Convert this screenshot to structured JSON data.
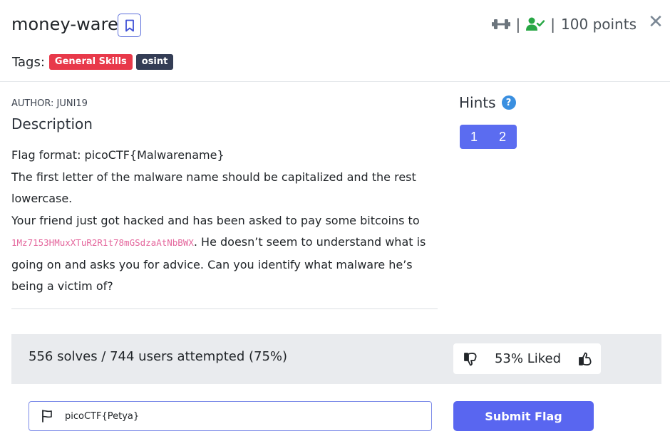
{
  "challenge": {
    "title": "money-ware",
    "points_label": "100 points",
    "separator": "|",
    "close_glyph": "✕"
  },
  "tags": {
    "label": "Tags:",
    "items": [
      {
        "name": "General Skills",
        "color": "#e8394a"
      },
      {
        "name": "osint",
        "color": "#343d55"
      }
    ]
  },
  "author": "AUTHOR: JUNI19",
  "description": {
    "heading": "Description",
    "line1": "Flag format: picoCTF{Malwarename}",
    "line2": "The first letter of the malware name should be capitalized and the rest lowercase.",
    "line3_pre": "Your friend just got hacked and has been asked to pay some bitcoins to ",
    "wallet": "1Mz7153HMuxXTuR2R1t78mGSdzaAtNbBWX",
    "line3_post": ". He doesn’t seem to understand what is going on and asks you for advice. Can you identify what malware he’s being a victim of?"
  },
  "hints": {
    "heading": "Hints",
    "help_glyph": "?",
    "buttons": [
      "1",
      "2"
    ]
  },
  "stats": {
    "solves_text": "556 solves / 744 users attempted (75%)",
    "liked_text": "53% Liked"
  },
  "flag": {
    "value": "picoCTF{Petya}",
    "submit_label": "Submit Flag"
  },
  "colors": {
    "accent": "#5966f0",
    "solved_green": "#28a745",
    "wallet_pink": "#e4669c"
  },
  "icons": [
    "bookmark-icon",
    "dumbbell-icon",
    "user-check-icon",
    "close-icon",
    "help-icon",
    "thumbs-down-icon",
    "thumbs-up-icon",
    "flag-icon"
  ]
}
